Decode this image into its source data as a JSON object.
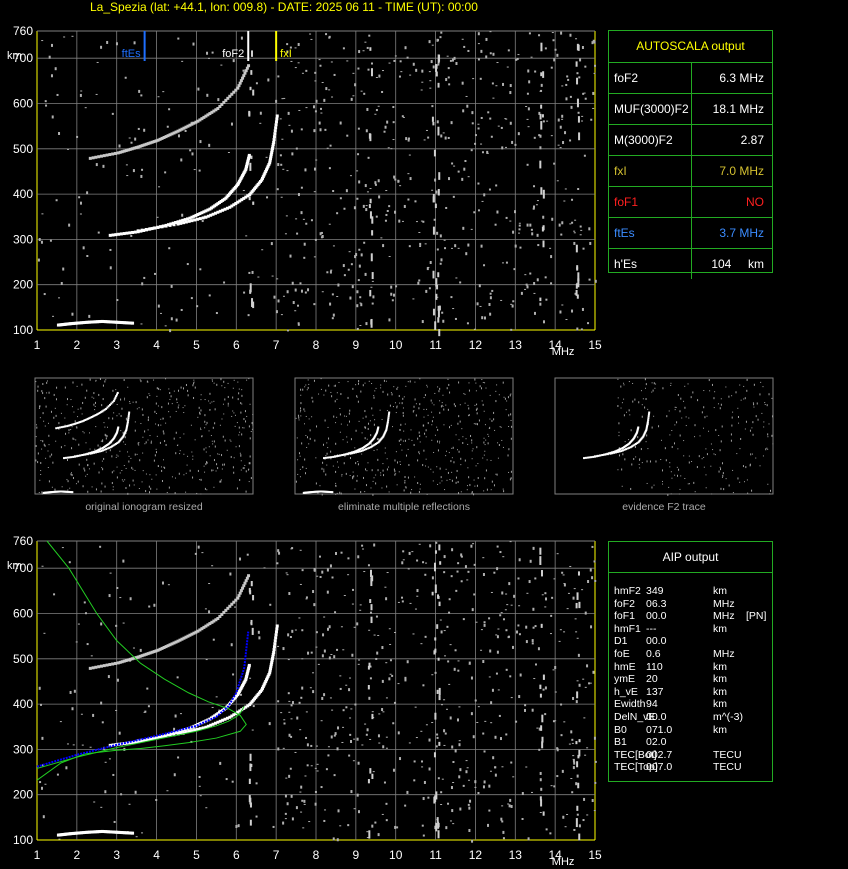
{
  "header": {
    "title": "La_Spezia (lat: +44.1, lon: 009.8) - DATE: 2025 06 11 - TIME (UT): 00:00"
  },
  "colors": {
    "axis": "#ffff00",
    "grid": "#808080",
    "panel_border": "#22aa22",
    "trace": "#ffffff",
    "noise": "#b0b0b0",
    "es_marker": "#1e6fff",
    "fof2_marker": "#ffffff",
    "fxi_marker": "#ffff00",
    "model_profile": "#0000ff",
    "model_curve": "#22cc22",
    "fof1_text": "#ff2020"
  },
  "chart_data": [
    {
      "type": "scatter",
      "title": "",
      "xlabel": "MHz",
      "ylabel": "km",
      "xlim": [
        1,
        15
      ],
      "ylim": [
        100,
        760
      ],
      "xticks": [
        "1",
        "2",
        "3",
        "4",
        "5",
        "6",
        "7",
        "8",
        "9",
        "10",
        "11",
        "12",
        "13",
        "14",
        "15"
      ],
      "yticks": [
        "100",
        "200",
        "300",
        "400",
        "500",
        "600",
        "700",
        "760"
      ],
      "grid": true,
      "markers": [
        {
          "label": "ftEs",
          "x": 3.7,
          "color": "#1e6fff"
        },
        {
          "label": "foF2",
          "x": 6.3,
          "color": "#ffffff"
        },
        {
          "label": "fxI",
          "x": 7.0,
          "color": "#ffff00"
        }
      ],
      "series": [
        {
          "x": [
            2.8,
            3.5,
            4.2,
            4.8,
            5.3,
            5.7,
            6.0,
            6.2,
            6.3
          ],
          "y": [
            310,
            318,
            332,
            348,
            368,
            392,
            422,
            455,
            490
          ]
        },
        {
          "x": [
            3.5,
            4.5,
            5.2,
            5.8,
            6.3,
            6.6,
            6.8,
            6.9,
            7.0
          ],
          "y": [
            320,
            335,
            350,
            372,
            400,
            432,
            470,
            515,
            580
          ]
        },
        {
          "x": [
            2.3,
            3.0,
            3.5,
            4.0,
            4.5,
            5.0,
            5.5,
            6.0,
            6.3
          ],
          "y": [
            480,
            492,
            505,
            520,
            540,
            562,
            590,
            635,
            690
          ]
        },
        {
          "x": [
            1.5,
            1.8,
            2.2,
            2.6,
            3.0,
            3.4
          ],
          "y": [
            112,
            115,
            118,
            120,
            118,
            116
          ]
        }
      ]
    },
    {
      "type": "scatter",
      "title": "",
      "xlabel": "MHz",
      "ylabel": "km",
      "xlim": [
        1,
        15
      ],
      "ylim": [
        100,
        760
      ],
      "xticks": [
        "1",
        "2",
        "3",
        "4",
        "5",
        "6",
        "7",
        "8",
        "9",
        "10",
        "11",
        "12",
        "13",
        "14",
        "15"
      ],
      "yticks": [
        "100",
        "200",
        "300",
        "400",
        "500",
        "600",
        "700",
        "760"
      ],
      "grid": true,
      "series": [
        {
          "x": [
            2.8,
            3.5,
            4.2,
            4.8,
            5.3,
            5.7,
            6.0,
            6.2,
            6.3
          ],
          "y": [
            310,
            318,
            332,
            348,
            368,
            392,
            422,
            455,
            490
          ]
        },
        {
          "x": [
            3.5,
            4.5,
            5.2,
            5.8,
            6.3,
            6.6,
            6.8,
            6.9,
            7.0
          ],
          "y": [
            320,
            335,
            350,
            372,
            400,
            432,
            470,
            515,
            580
          ]
        },
        {
          "x": [
            2.3,
            3.0,
            3.5,
            4.0,
            4.5,
            5.0,
            5.5,
            6.0,
            6.3
          ],
          "y": [
            480,
            492,
            505,
            520,
            540,
            562,
            590,
            635,
            690
          ]
        },
        {
          "x": [
            1.5,
            1.8,
            2.2,
            2.6,
            3.0,
            3.4
          ],
          "y": [
            112,
            115,
            118,
            120,
            118,
            116
          ]
        }
      ],
      "model_profile": {
        "x": [
          1.0,
          2.0,
          3.0,
          4.0,
          5.0,
          5.5,
          5.8,
          6.0,
          6.2,
          6.3
        ],
        "y": [
          262,
          288,
          310,
          330,
          352,
          372,
          395,
          425,
          480,
          560
        ]
      },
      "model_curves": [
        {
          "x": [
            1.25,
            1.8,
            2.5,
            3.0,
            3.6,
            4.2,
            4.8,
            5.3,
            5.8,
            6.1,
            6.25,
            6.1,
            5.5,
            4.8,
            4.2,
            3.6,
            3.0,
            2.2,
            1.6,
            1.0
          ],
          "y": [
            760,
            700,
            600,
            540,
            490,
            455,
            425,
            405,
            390,
            375,
            355,
            340,
            325,
            315,
            308,
            302,
            298,
            290,
            270,
            232
          ]
        },
        {
          "x": [
            1.0,
            2.0,
            3.0,
            4.0,
            5.0,
            5.5,
            5.8,
            6.0,
            6.1,
            6.2
          ],
          "y": [
            258,
            283,
            304,
            322,
            340,
            352,
            362,
            372,
            380,
            395
          ]
        }
      ]
    }
  ],
  "autoscala": {
    "title": "AUTOSCALA output",
    "rows": [
      {
        "key": "foF2",
        "value": "6.3 MHz",
        "key_color": "#ffffff",
        "value_color": "#ffffff"
      },
      {
        "key": "MUF(3000)F2",
        "value": "18.1 MHz",
        "key_color": "#ffffff",
        "value_color": "#ffffff"
      },
      {
        "key": "M(3000)F2",
        "value": "2.87",
        "key_color": "#ffffff",
        "value_color": "#ffffff"
      },
      {
        "key": "fxI",
        "value": "7.0 MHz",
        "key_color": "#d4c030",
        "value_color": "#d4c030"
      },
      {
        "key": "foF1",
        "value": "NO",
        "key_color": "#ff2020",
        "value_color": "#ff2020"
      },
      {
        "key": "ftEs",
        "value": "3.7 MHz",
        "key_color": "#3b8cff",
        "value_color": "#3b8cff"
      },
      {
        "key": "h'Es",
        "value": "104     km",
        "key_color": "#ffffff",
        "value_color": "#ffffff"
      }
    ]
  },
  "aip": {
    "title": "AIP output",
    "rows": [
      {
        "k": "hmF2",
        "v": "349",
        "u": "km",
        "x": ""
      },
      {
        "k": "foF2",
        "v": "06.3",
        "u": "MHz",
        "x": ""
      },
      {
        "k": "foF1",
        "v": "00.0",
        "u": "MHz",
        "x": "[PN]"
      },
      {
        "k": "hmF1",
        "v": "---",
        "u": "km",
        "x": ""
      },
      {
        "k": "D1",
        "v": "00.0",
        "u": "",
        "x": ""
      },
      {
        "k": "foE",
        "v": "0.6",
        "u": "MHz",
        "x": ""
      },
      {
        "k": "hmE",
        "v": "110",
        "u": "km",
        "x": ""
      },
      {
        "k": "ymE",
        "v": "20",
        "u": "km",
        "x": ""
      },
      {
        "k": "h_vE",
        "v": "137",
        "u": "km",
        "x": ""
      },
      {
        "k": "Ewidth",
        "v": "94",
        "u": "km",
        "x": ""
      },
      {
        "k": "DelN_vE",
        "v": "00.0",
        "u": "m^(-3)",
        "x": ""
      },
      {
        "k": "B0",
        "v": "071.0",
        "u": "km",
        "x": ""
      },
      {
        "k": "B1",
        "v": "02.0",
        "u": "",
        "x": ""
      },
      {
        "k": "TEC[Bot]",
        "v": "002.7",
        "u": "TECU",
        "x": ""
      },
      {
        "k": "TEC[Top]",
        "v": "007.0",
        "u": "TECU",
        "x": ""
      }
    ]
  },
  "thumbnails": [
    {
      "caption": "original ionogram resized"
    },
    {
      "caption": "eliminate multiple reflections"
    },
    {
      "caption": "evidence F2 trace"
    }
  ]
}
